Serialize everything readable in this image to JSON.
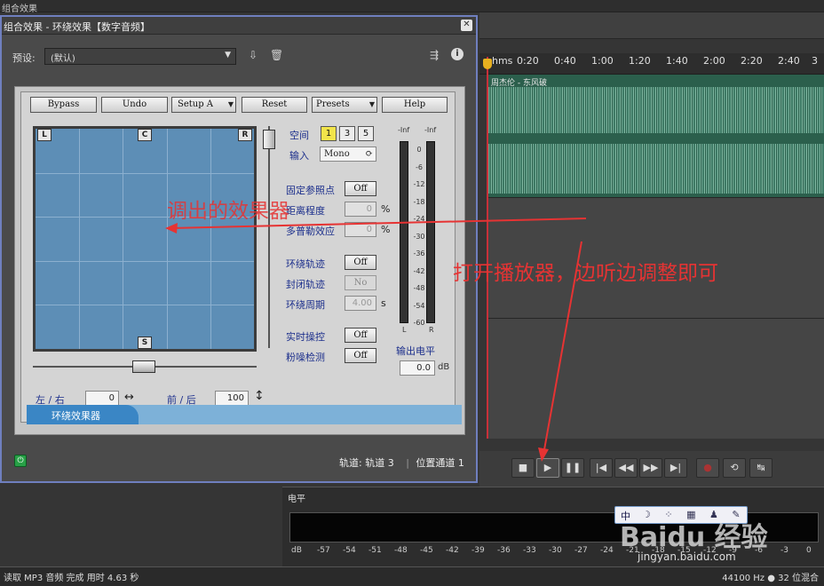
{
  "background": {
    "top_left_text": "组合效果",
    "ruler": {
      "unit": "hms",
      "ticks": [
        "0:20",
        "0:40",
        "1:00",
        "1:20",
        "1:40",
        "2:00",
        "2:20",
        "2:40",
        "3"
      ]
    },
    "track_name": "周杰伦 - 东风破",
    "meter_panel": {
      "tab_label": "电平",
      "scale": [
        "dB",
        "-57",
        "-54",
        "-51",
        "-48",
        "-45",
        "-42",
        "-39",
        "-36",
        "-33",
        "-30",
        "-27",
        "-24",
        "-21",
        "-18",
        "-15",
        "-12",
        "-9",
        "-6",
        "-3",
        "0"
      ]
    },
    "status": {
      "left": "读取 MP3 音频 完成 用时 4.63 秒",
      "right": "44100 Hz ● 32 位混合"
    },
    "transport_icons": [
      "stop-icon",
      "play-icon",
      "pause-icon",
      "go-to-start-icon",
      "rewind-icon",
      "fast-forward-icon",
      "go-to-end-icon",
      "record-icon",
      "loop-icon",
      "skip-icon"
    ],
    "watermark": "Baidu 经验",
    "watermark_sub": "jingyan.baidu.com",
    "ime_bar": "中"
  },
  "dialog": {
    "title": "组合效果 - 环绕效果【数字音频】",
    "preset_label": "预设:",
    "preset_value": "(默认)",
    "footer_track": "轨道: 轨道 3",
    "footer_position": "位置通道 1",
    "plugin": {
      "buttons": {
        "bypass": "Bypass",
        "undo": "Undo",
        "setup": "Setup A",
        "reset": "Reset",
        "presets": "Presets",
        "help": "Help"
      },
      "speakers": {
        "left": "L",
        "center": "C",
        "right": "R",
        "surround": "S"
      },
      "space_label": "空间",
      "space_options": [
        "1",
        "3",
        "5"
      ],
      "input_label": "输入",
      "input_value": "Mono",
      "params": [
        {
          "label": "固定参照点",
          "value": "Off",
          "kind": "button"
        },
        {
          "label": "距离程度",
          "value": "0",
          "unit": "%",
          "kind": "field"
        },
        {
          "label": "多普勒效应",
          "value": "0",
          "unit": "%",
          "kind": "field"
        },
        {
          "label": "环绕轨迹",
          "value": "Off",
          "kind": "button"
        },
        {
          "label": "封闭轨迹",
          "value": "No",
          "kind": "button-disabled"
        },
        {
          "label": "环绕周期",
          "value": "4.00",
          "unit": "s",
          "kind": "field"
        },
        {
          "label": "实时操控",
          "value": "Off",
          "kind": "button"
        },
        {
          "label": "粉噪检测",
          "value": "Off",
          "kind": "button"
        }
      ],
      "meter_top": [
        "-Inf",
        "-Inf"
      ],
      "meter_scale": [
        "0",
        "-6",
        "-12",
        "-18",
        "-24",
        "-30",
        "-36",
        "-42",
        "-48",
        "-54",
        "-60"
      ],
      "meter_channels": [
        "L",
        "R"
      ],
      "output_level_label": "输出电平",
      "output_level_value": "0.0",
      "output_level_unit": "dB",
      "lr_label": "左 / 右",
      "lr_value": "0",
      "fb_label": "前 / 后",
      "fb_value": "100",
      "tab_label": "环绕效果器"
    }
  },
  "annotations": {
    "a1": "调出的效果器",
    "a2": "打开播放器，边听边调整即可"
  },
  "colors": {
    "annotation": "#e63333",
    "pad": "#5d8eb6",
    "waveform": "#2b5f4c",
    "accent_tab": "#3a86c5"
  }
}
